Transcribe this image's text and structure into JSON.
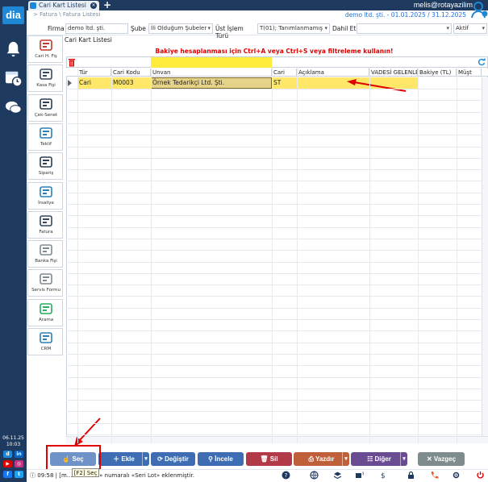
{
  "app": {
    "logo": "dia",
    "user": "melis@rotayazilim",
    "company_period": "demo ltd. şti. - 01.01.2025 / 31.12.2025"
  },
  "tab": {
    "title": "Cari Kart Listesi",
    "close": "×",
    "new": "+"
  },
  "breadcrumb": "> Fatura \\ Fatura Listesi",
  "filters": {
    "firma_label": "Firma",
    "firma_value": "demo ltd. şti.",
    "sube_label": "Şube",
    "sube_value": "İli Olduğum Şubeler",
    "ust_islem_label": "Üst İşlem Türü",
    "ust_islem_value": "T(01); Tanımlanmamış",
    "dahil_et_label": "Dahil Et",
    "dahil_et_value": "",
    "status_value": "Aktif"
  },
  "modules": [
    {
      "label": "Cari H. Fiş",
      "icon": "account-card-icon"
    },
    {
      "label": "Kasa Fişi",
      "icon": "cash-register-icon"
    },
    {
      "label": "Çek-Senet",
      "icon": "cheque-icon"
    },
    {
      "label": "Teklif",
      "icon": "offer-icon"
    },
    {
      "label": "Sipariş",
      "icon": "order-icon"
    },
    {
      "label": "İrsaliye",
      "icon": "delivery-truck-icon"
    },
    {
      "label": "Fatura",
      "icon": "invoice-icon"
    },
    {
      "label": "Banka Fişi",
      "icon": "bank-icon"
    },
    {
      "label": "Servis Formu",
      "icon": "service-icon"
    },
    {
      "label": "Arama",
      "icon": "phone-icon"
    },
    {
      "label": "CRM",
      "icon": "crm-icon"
    }
  ],
  "grid": {
    "title": "Cari Kart Listesi",
    "warning": "Bakiye hesaplanması için Ctrl+A veya Ctrl+S veya filtreleme kullanın!",
    "columns": [
      "Tür",
      "Cari Kodu",
      "Unvan",
      "Cari",
      "Açıklama",
      "VADESİ GELENLE",
      "Bakiye (TL)",
      "Müşt"
    ],
    "rows": [
      {
        "tur": "Cari",
        "kod": "M0003",
        "unvan": "Örnek Tedarikçi Ltd. Şti.",
        "cari": "ST",
        "aciklama": "",
        "vade": "",
        "bakiye": "",
        "must": ""
      }
    ]
  },
  "buttons": {
    "sec": "Seç",
    "ekle": "Ekle",
    "degistir": "Değiştir",
    "incele": "İncele",
    "sil": "Sil",
    "yazdir": "Yazdır",
    "diger": "Diğer",
    "vazgec": "Vazgeç",
    "tooltip": "[F2] Seç"
  },
  "status": {
    "time": "09:58",
    "message": "| [m.... 2025-01» numaralı «Seri Lot» eklenmiştir."
  },
  "sidebar_clock": {
    "date": "06.11.25",
    "time": "10:03"
  },
  "colors": {
    "rail": "#1f3a5f",
    "accent": "#1e88d6",
    "row_highlight": "#ffe76a",
    "warning": "#e00000"
  }
}
